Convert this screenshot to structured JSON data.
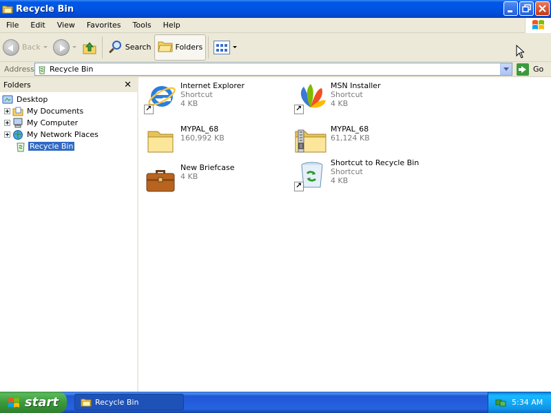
{
  "window": {
    "title": "Recycle Bin"
  },
  "menu": [
    "File",
    "Edit",
    "View",
    "Favorites",
    "Tools",
    "Help"
  ],
  "toolbar": {
    "back": "Back",
    "search": "Search",
    "folders": "Folders"
  },
  "address": {
    "label": "Address",
    "value": "Recycle Bin",
    "go": "Go"
  },
  "folders_pane": {
    "title": "Folders",
    "close": "✕",
    "tree": [
      {
        "label": "Desktop",
        "icon": "desktop-icon"
      },
      {
        "label": "My Documents",
        "icon": "my-documents-icon"
      },
      {
        "label": "My Computer",
        "icon": "my-computer-icon"
      },
      {
        "label": "My Network Places",
        "icon": "network-places-icon"
      },
      {
        "label": "Recycle Bin",
        "icon": "recycle-bin-icon",
        "selected": true
      }
    ]
  },
  "items": [
    {
      "name": "Internet Explorer",
      "type": "Shortcut",
      "size": "4 KB",
      "icon": "internet-explorer-icon"
    },
    {
      "name": "MSN Installer",
      "type": "Shortcut",
      "size": "4 KB",
      "icon": "msn-icon"
    },
    {
      "name": "MYPAL_68",
      "type": "",
      "size": "160,992 KB",
      "icon": "folder-icon"
    },
    {
      "name": "MYPAL_68",
      "type": "",
      "size": "61,124 KB",
      "icon": "zip-folder-icon"
    },
    {
      "name": "New Briefcase",
      "type": "",
      "size": "4 KB",
      "icon": "briefcase-icon"
    },
    {
      "name": "Shortcut to Recycle Bin",
      "type": "Shortcut",
      "size": "4 KB",
      "icon": "recycle-bin-icon"
    }
  ],
  "taskbar": {
    "start": "start",
    "task": "Recycle Bin",
    "clock": "5:34 AM"
  },
  "colors": {
    "titlebar": "#0054e3",
    "selection": "#316ac5",
    "start": "#3c9a3c",
    "tray": "#18b9ff"
  }
}
